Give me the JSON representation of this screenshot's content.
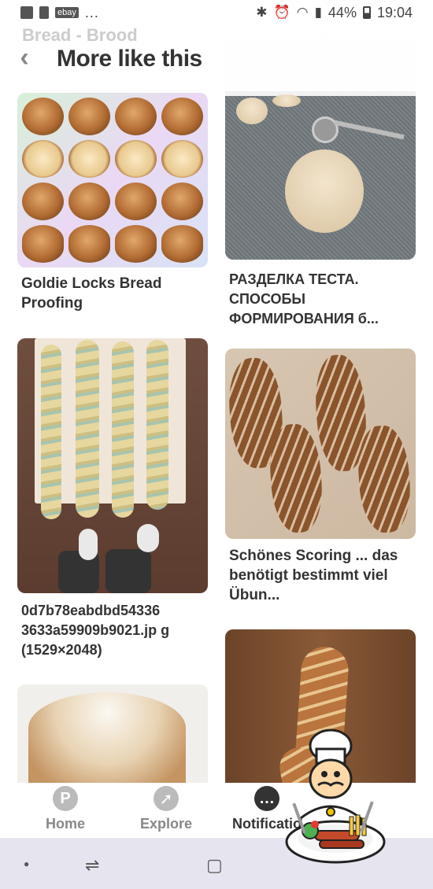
{
  "status_bar": {
    "left_icons": [
      "image-icon",
      "sim-icon",
      "ebay-icon"
    ],
    "ebay_label": "ebay",
    "more": "...",
    "battery": "44%",
    "time": "19:04"
  },
  "header": {
    "ghost_text": "Bread - Brood",
    "title": "More like this"
  },
  "pins": [
    {
      "title": "Goldie Locks Bread Proofing"
    },
    {
      "title": "РАЗДЕЛКА ТЕСТА. СПОСОБЫ ФОРМИРОВАНИЯ б..."
    },
    {
      "title": "0d7b78eabdbd54336 3633a59909b9021.jp g (1529×2048)"
    },
    {
      "title": "Schönes Scoring ... das benötigt bestimmt viel Übun..."
    },
    {
      "title": ""
    },
    {
      "title": ""
    }
  ],
  "bottom_nav": {
    "home": "Home",
    "explore": "Explore",
    "notifications": "Notificatio",
    "pinterest_color": "#bbbbbb"
  }
}
